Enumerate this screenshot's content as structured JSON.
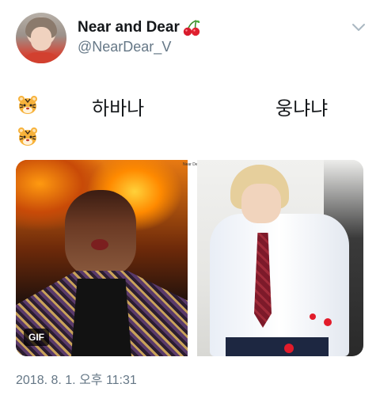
{
  "tweet": {
    "display_name": "Near and Dear",
    "name_emoji": "cherry-emoji",
    "handle": "@NearDear_V",
    "menu_icon": "chevron-down-icon",
    "lines": [
      {
        "emoji": "tiger-face-emoji",
        "label": "하바나"
      },
      {
        "emoji": "tiger-face-emoji",
        "label": "웅냐냐"
      }
    ],
    "media": {
      "badge": "GIF",
      "watermark": "Near Dear"
    },
    "timestamp": "2018. 8. 1. 오후 11:31"
  },
  "colors": {
    "text_primary": "#14171a",
    "text_secondary": "#657786",
    "background": "#ffffff"
  }
}
